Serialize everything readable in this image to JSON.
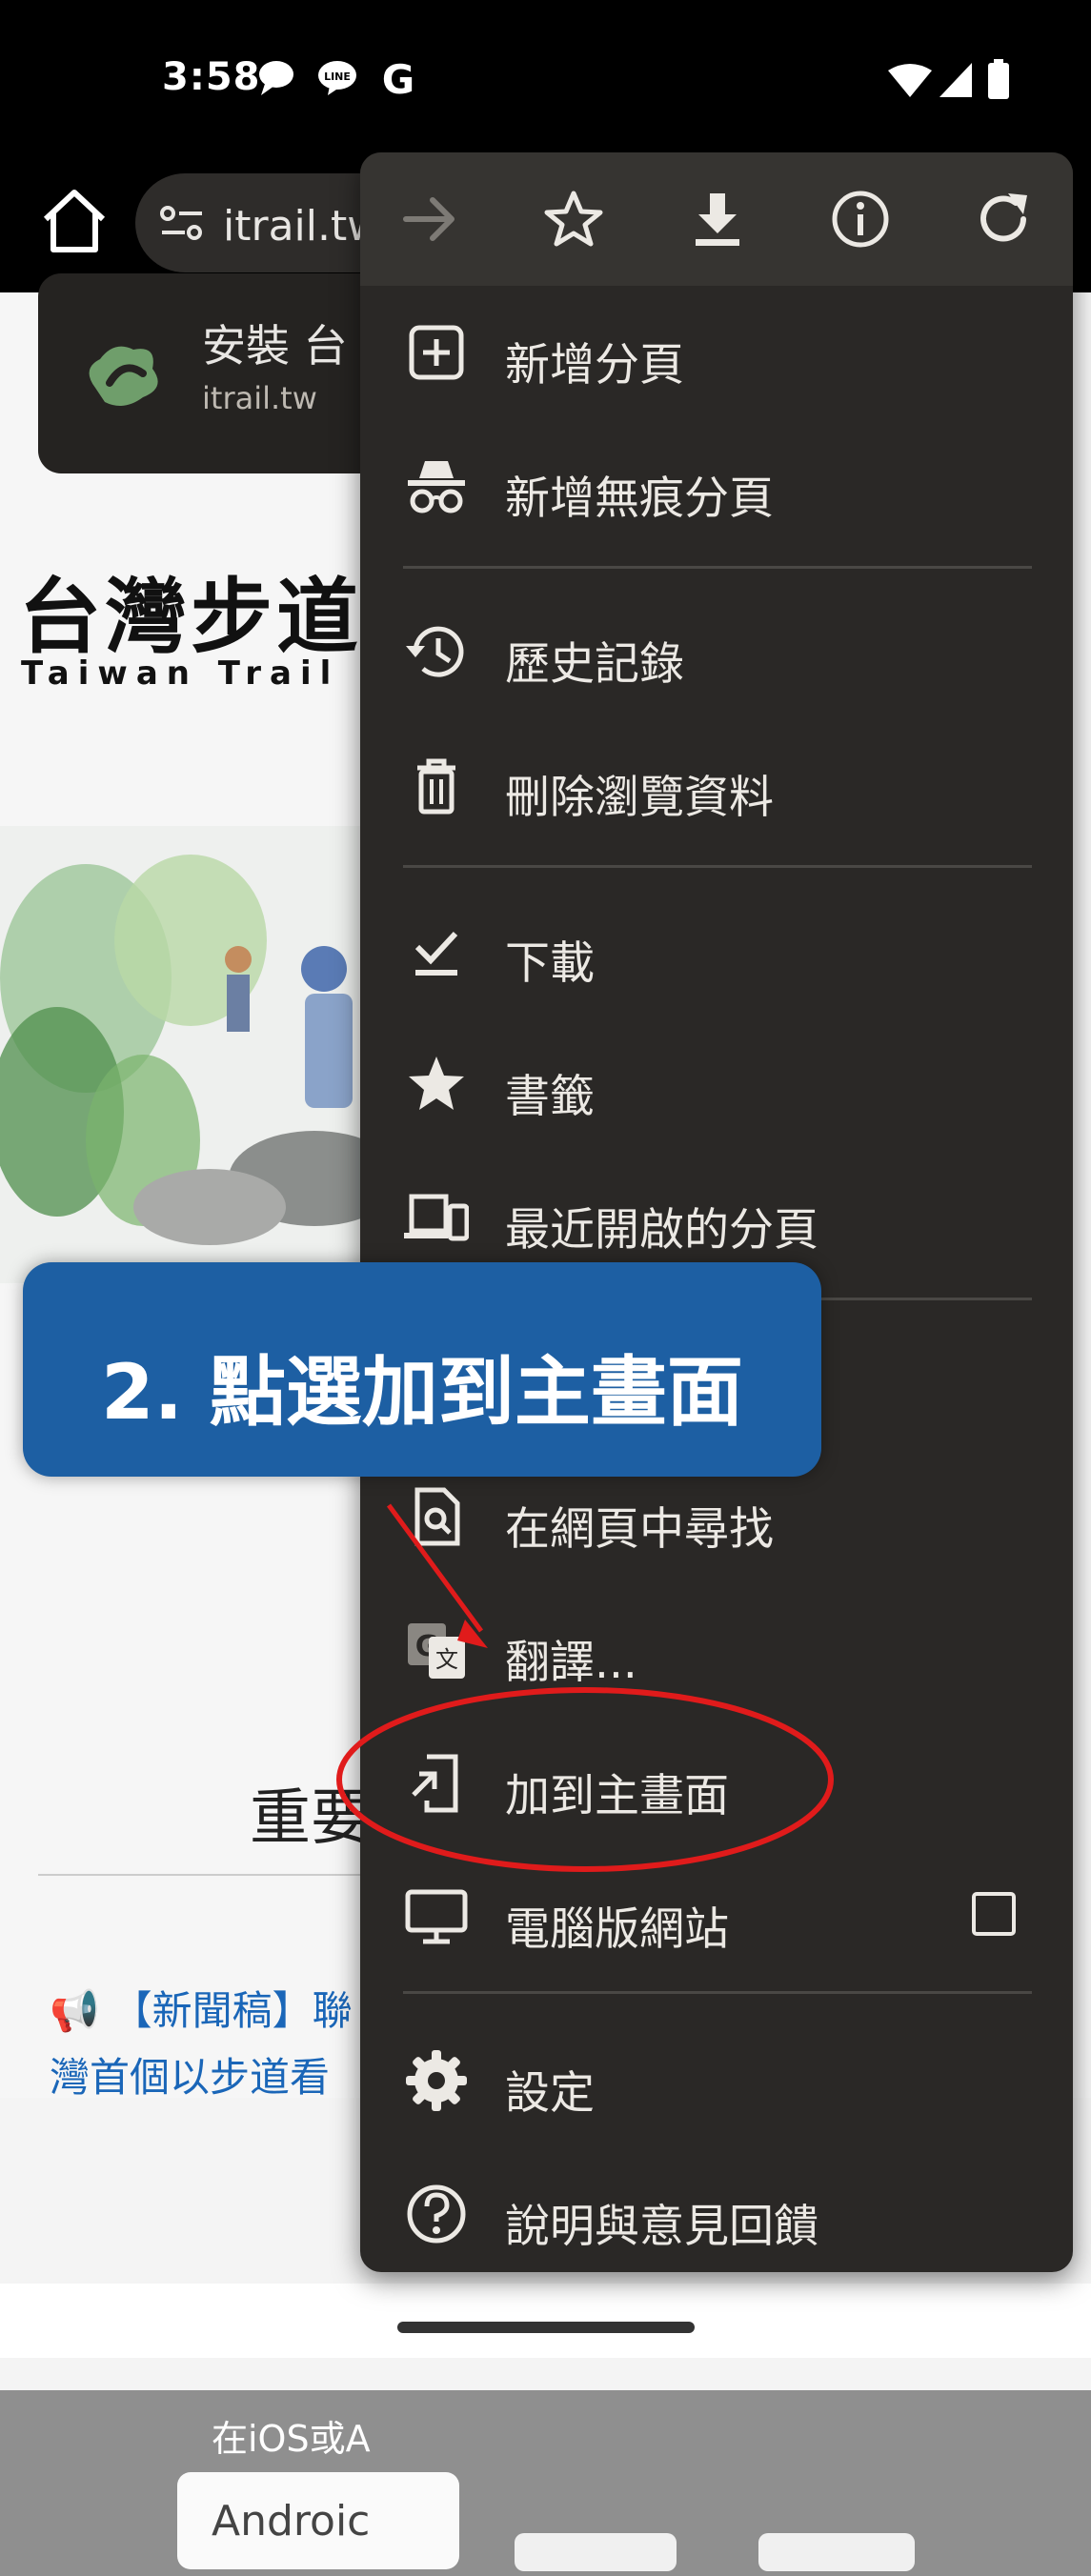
{
  "status_bar": {
    "time": "3:58",
    "left_icons": [
      "chat-bubble-icon",
      "line-app-icon",
      "google-g-icon"
    ],
    "right_icons": [
      "wifi-icon",
      "signal-icon",
      "battery-icon"
    ]
  },
  "browser": {
    "url": "itrail.tw",
    "home_icon": "home-icon",
    "site_settings_icon": "site-settings-icon"
  },
  "install_banner": {
    "title": "安裝 台",
    "host": "itrail.tw"
  },
  "page": {
    "site_title": "台灣步道",
    "site_subtitle": "Taiwan Trail",
    "important_heading": "重要",
    "news_line1": "📢 【新聞稿】聯",
    "news_line2": "灣首個以步道看",
    "bottom_text": "在iOS或A",
    "android_button": "Androic"
  },
  "menu": {
    "top_icons": [
      "forward-arrow-icon",
      "bookmark-star-icon",
      "download-icon",
      "page-info-icon",
      "refresh-icon"
    ],
    "items": [
      {
        "label": "新增分頁",
        "icon": "new-tab-icon"
      },
      {
        "label": "新增無痕分頁",
        "icon": "incognito-icon"
      },
      {
        "label": "歷史記錄",
        "icon": "history-icon"
      },
      {
        "label": "刪除瀏覽資料",
        "icon": "trash-icon"
      },
      {
        "label": "下載",
        "icon": "downloads-icon"
      },
      {
        "label": "書籤",
        "icon": "bookmarks-star-icon"
      },
      {
        "label": "最近開啟的分頁",
        "icon": "recent-tabs-icon"
      },
      {
        "label": "在網頁中尋找",
        "icon": "find-in-page-icon"
      },
      {
        "label": "翻譯...",
        "icon": "translate-icon"
      },
      {
        "label": "加到主畫面",
        "icon": "add-to-home-icon"
      },
      {
        "label": "電腦版網站",
        "icon": "desktop-icon",
        "checkbox_checked": false
      },
      {
        "label": "設定",
        "icon": "settings-gear-icon"
      },
      {
        "label": "說明與意見回饋",
        "icon": "help-icon"
      }
    ]
  },
  "annotation": {
    "callout_text": "2. 點選加到主畫面",
    "callout_color": "#1d5fa3",
    "highlight_color": "#e01b1b"
  }
}
